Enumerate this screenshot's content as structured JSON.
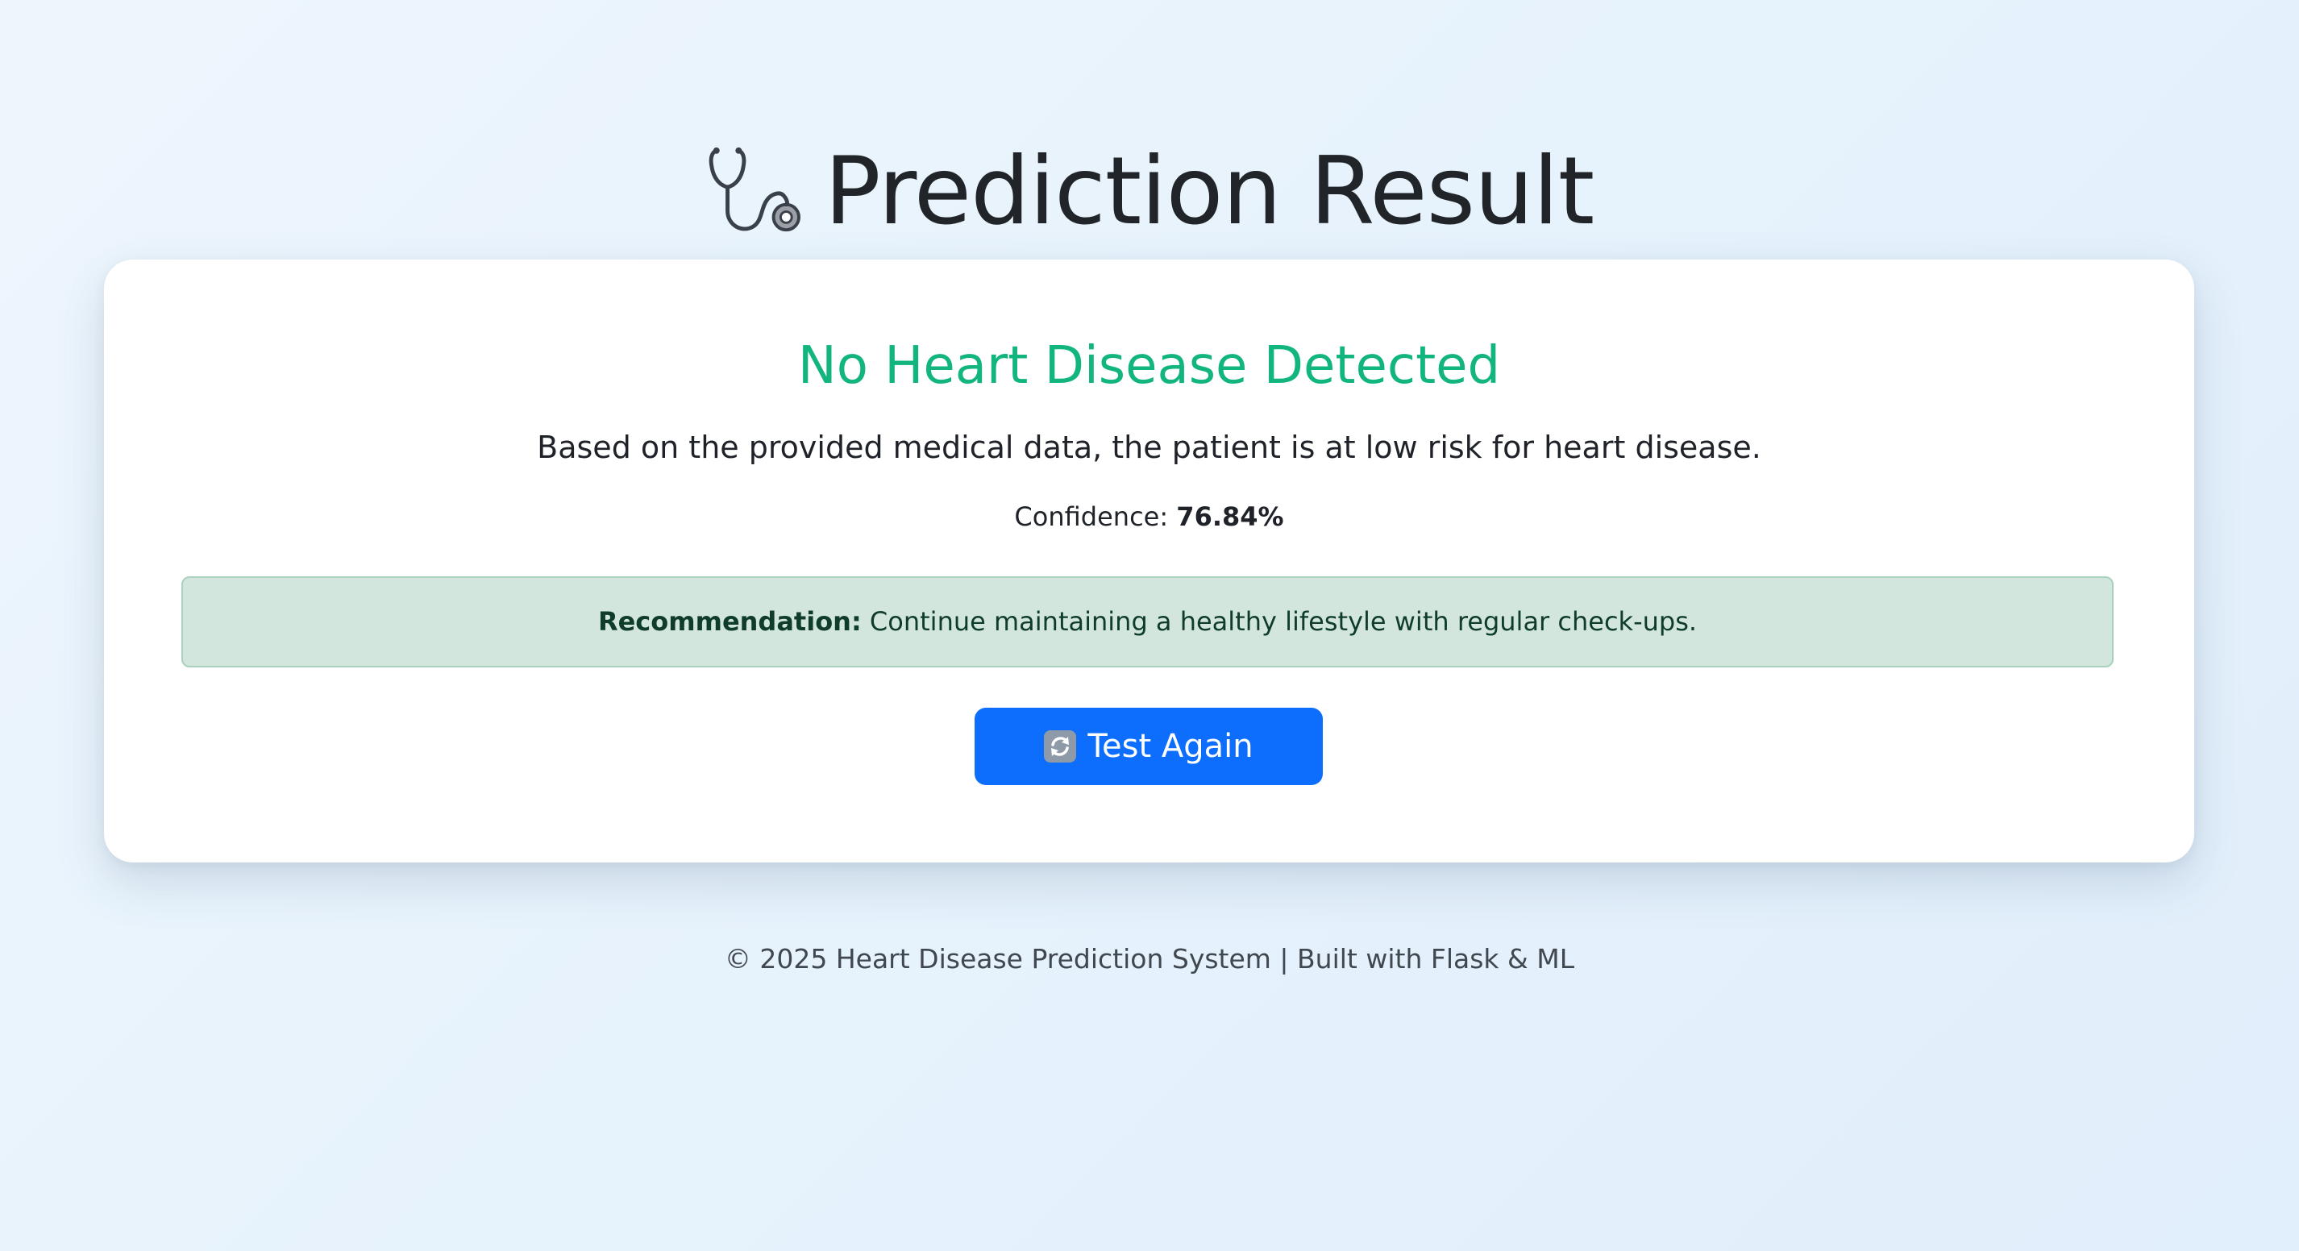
{
  "header": {
    "icon": "stethoscope-icon",
    "title": "Prediction Result"
  },
  "result": {
    "heading": "No Heart Disease Detected",
    "description": "Based on the provided medical data, the patient is at low risk for heart disease.",
    "confidence_label": "Confidence:",
    "confidence_value": "76.84%",
    "status_color": "#12b57e"
  },
  "recommendation": {
    "label": "Recommendation:",
    "text": "Continue maintaining a healthy lifestyle with regular check-ups.",
    "background_color": "#d2e6de"
  },
  "actions": {
    "test_again_icon": "refresh-icon",
    "test_again_label": "Test Again",
    "button_color": "#0d6efd"
  },
  "footer": {
    "text": "© 2025 Heart Disease Prediction System | Built with Flask & ML"
  }
}
